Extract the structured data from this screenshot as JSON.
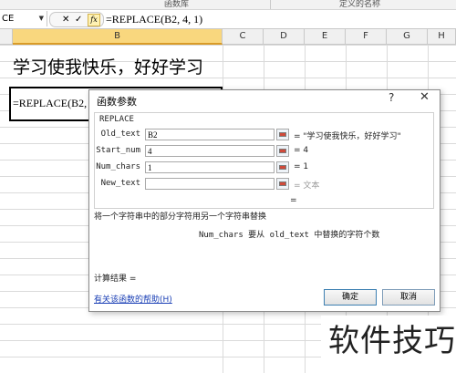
{
  "ribbon": {
    "group_left": "函数库",
    "group_right": "定义的名称"
  },
  "formula_bar": {
    "name_box": "CE",
    "cancel_glyph": "✕",
    "enter_glyph": "✓",
    "fx_glyph": "fx",
    "formula": "=REPLACE(B2, 4, 1)"
  },
  "columns": [
    "B",
    "C",
    "D",
    "E",
    "F",
    "G",
    "H"
  ],
  "selected_column": "B",
  "cells": {
    "b1": "学习使我快乐，好好学习",
    "b2": "=REPLACE(B2, 4, 1)"
  },
  "dialog": {
    "title": "函数参数",
    "help_glyph": "?",
    "close_glyph": "✕",
    "function_name": "REPLACE",
    "args": [
      {
        "label": "Old_text",
        "value": "B2",
        "result": "= \"学习使我快乐，好好学习\"",
        "dim": false
      },
      {
        "label": "Start_num",
        "value": "4",
        "result": "= 4",
        "dim": false
      },
      {
        "label": "Num_chars",
        "value": "1",
        "result": "= 1",
        "dim": false
      },
      {
        "label": "New_text",
        "value": "",
        "result": "= 文本",
        "dim": true
      }
    ],
    "equals_line": "=",
    "description": "将一个字符串中的部分字符用另一个字符串替换",
    "arg_description": "Num_chars  要从 old_text 中替换的字符个数",
    "calc_result": "计算结果 =",
    "help_link": "有关该函数的帮助(H)",
    "ok_label": "确定",
    "cancel_label": "取消"
  },
  "watermark": "软件技巧"
}
